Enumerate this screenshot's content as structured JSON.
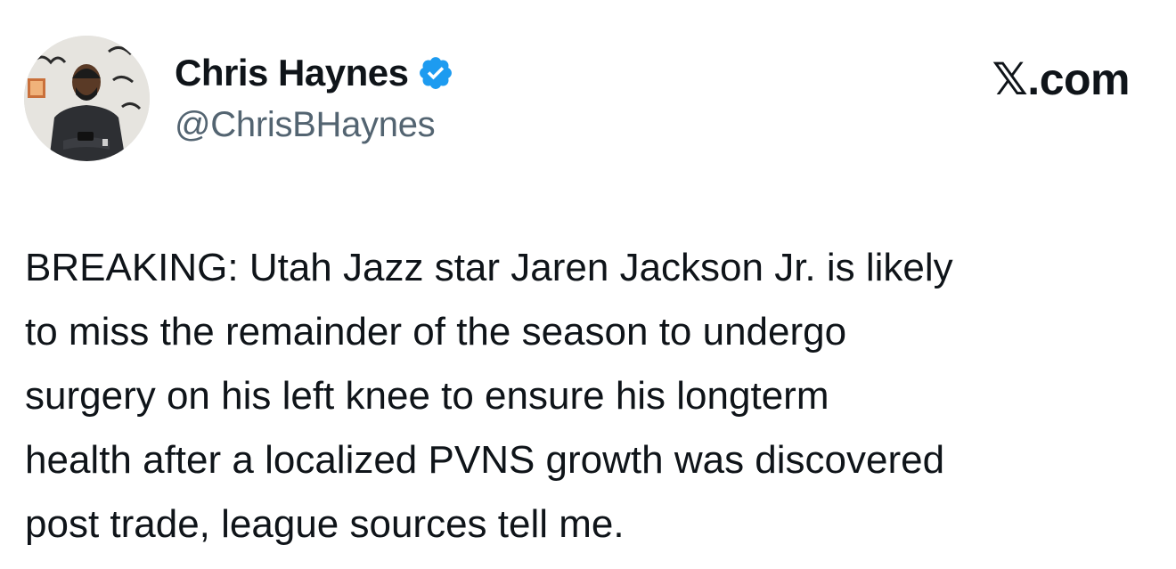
{
  "author": {
    "display_name": "Chris Haynes",
    "handle": "@ChrisBHaynes",
    "verified": true,
    "verified_icon": "verified-badge-icon",
    "verified_color": "#1d9bf0",
    "avatar_icon": "profile-photo"
  },
  "source": {
    "label": "𝕏.com"
  },
  "tweet": {
    "lines": [
      "BREAKING: Utah Jazz star Jaren Jackson Jr. is likely",
      "to miss the remainder of the season to undergo",
      "surgery on his left knee to ensure his longterm",
      "health after a localized PVNS growth was discovered",
      "post trade, league sources tell me."
    ]
  },
  "colors": {
    "text": "#0f1419",
    "secondary_text": "#536471",
    "background": "#ffffff"
  }
}
